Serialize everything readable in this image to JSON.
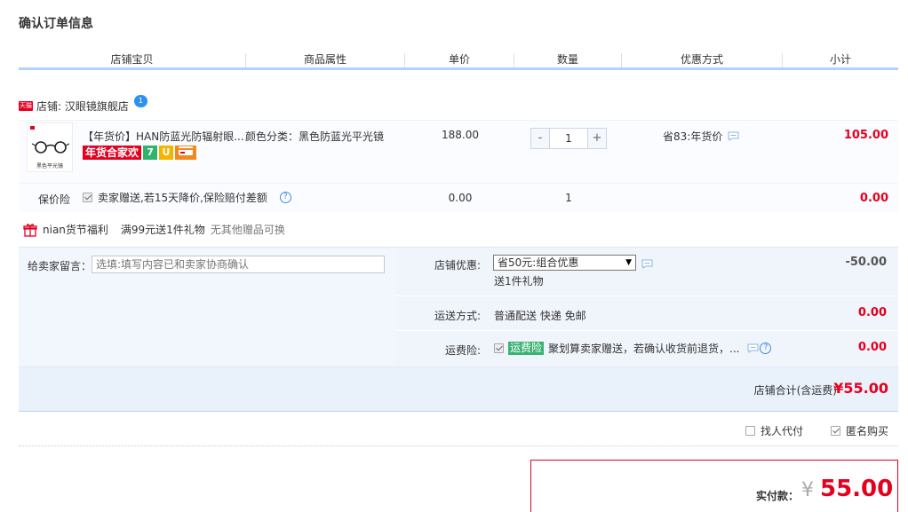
{
  "page": {
    "title": "确认订单信息"
  },
  "columns": [
    "店铺宝贝",
    "商品属性",
    "单价",
    "数量",
    "优惠方式",
    "小计"
  ],
  "shop": {
    "badge": "天猫",
    "label": "店铺: 汉眼镜旗舰店",
    "bubble": "1"
  },
  "item": {
    "thumb_caption": "黑色平光镜",
    "title": "【年货价】HAN防蓝光防辐射眼...",
    "attribute": "颜色分类：黑色防蓝光平光镜",
    "tag_main": "年货合家欢",
    "tag_seven": "7",
    "tag_shield": "U",
    "unit_price": "188.00",
    "quantity": "1",
    "minus": "-",
    "plus": "+",
    "discount": "省83:年货价",
    "subtotal": "105.00"
  },
  "insurance": {
    "label": "保价险",
    "text": "卖家赠送,若15天降价,保险赔付差额",
    "price": "0.00",
    "quantity": "1",
    "subtotal": "0.00"
  },
  "gift": {
    "title": "nian货节福利",
    "offer": "满99元送1件礼物",
    "note": "无其他赠品可换"
  },
  "message": {
    "label": "给卖家留言：",
    "value": "选填:填写内容已和卖家协商确认"
  },
  "shop_discount": {
    "label": "店铺优惠:",
    "selected": "省50元:组合优惠",
    "arrow": "▼",
    "note": "送1件礼物",
    "amount": "-50.00"
  },
  "shipping": {
    "label": "运送方式:",
    "value": "普通配送 快递 免邮",
    "amount": "0.00"
  },
  "freight_insurance": {
    "label": "运费险:",
    "tag": "运费险",
    "text": "聚划算卖家赠送，若确认收货前退货，...",
    "amount": "0.00"
  },
  "shop_total": {
    "label": "店铺合计(含运费)",
    "amount": "¥55.00"
  },
  "options": {
    "pay_for_me": "找人代付",
    "anonymous": "匿名购买"
  },
  "payment": {
    "label": "实付款：",
    "currency": "¥",
    "amount": "55.00"
  },
  "colors": {
    "accent_red": "#e5001f",
    "header_line": "#b2d1ff",
    "section_bg": "#f0f5fc",
    "tag_green": "#3bb273"
  }
}
